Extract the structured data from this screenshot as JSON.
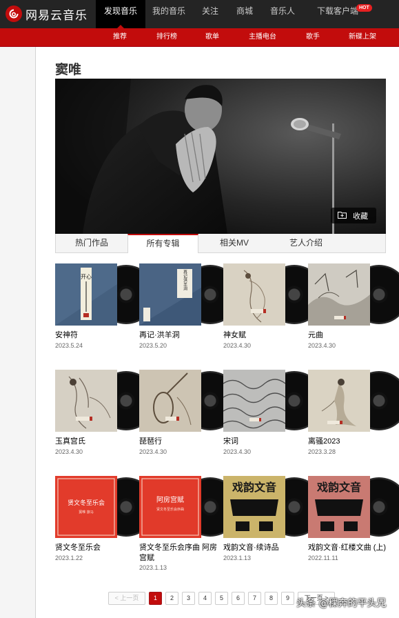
{
  "brand": {
    "name": "网易云音乐"
  },
  "topnav": [
    {
      "label": "发现音乐",
      "active": true
    },
    {
      "label": "我的音乐"
    },
    {
      "label": "关注"
    },
    {
      "label": "商城"
    },
    {
      "label": "音乐人"
    },
    {
      "label": "下载客户端"
    }
  ],
  "hot_badge": "HOT",
  "subnav": [
    "推荐",
    "排行榜",
    "歌单",
    "主播电台",
    "歌手",
    "新碟上架"
  ],
  "artist": {
    "name": "窦唯"
  },
  "banner": {
    "collect_label": "收藏"
  },
  "tabs": [
    "热门作品",
    "所有专辑",
    "相关MV",
    "艺人介绍"
  ],
  "active_tab": "所有专辑",
  "albums": [
    {
      "title": "安神符",
      "date": "2023.5.24"
    },
    {
      "title": "再记·洪羊洞",
      "date": "2023.5.20"
    },
    {
      "title": "神女赋",
      "date": "2023.4.30"
    },
    {
      "title": "元曲",
      "date": "2023.4.30"
    },
    {
      "title": "玉真宫氏",
      "date": "2023.4.30"
    },
    {
      "title": "琵琶行",
      "date": "2023.4.30"
    },
    {
      "title": "宋词",
      "date": "2023.4.30"
    },
    {
      "title": "离骚2023",
      "date": "2023.3.28"
    },
    {
      "title": "贤文冬至乐会",
      "date": "2023.1.22"
    },
    {
      "title": "贤文冬至乐会序曲 阿房宫赋",
      "date": "2023.1.13"
    },
    {
      "title": "戏韵文音·续诗品",
      "date": "2023.1.13"
    },
    {
      "title": "戏韵文音·红楼文曲 (上)",
      "date": "2022.11.11"
    }
  ],
  "cover_text": {
    "c1": "开心",
    "c2": "再记洪羊洞",
    "c9_title": "贤文冬至乐会",
    "c9_sub": "窦唯 旅马",
    "c10_title": "阿房宫赋",
    "c10_sub": "贤文冬至乐会序曲",
    "c11": "戏韵文音",
    "c12": "戏韵文音"
  },
  "pager": {
    "prev": "< 上一页",
    "pages": [
      "1",
      "2",
      "3",
      "4",
      "5",
      "6",
      "7",
      "8",
      "9"
    ],
    "current": "1",
    "next": "下一页 >"
  },
  "watermark": "头条 @稞奔的平头兄"
}
